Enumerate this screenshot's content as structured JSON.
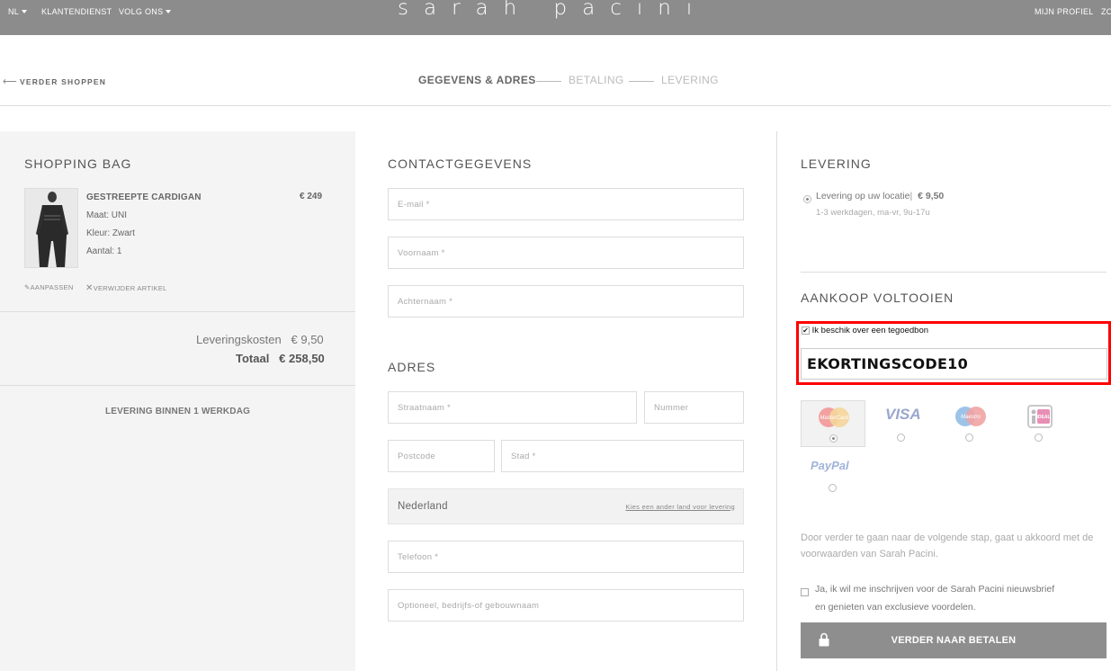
{
  "topbar": {
    "lang": "NL",
    "service": "KLANTENDIENST",
    "follow": "VOLG ONS",
    "logo": "sarah pacini",
    "profile": "MIJN PROFIEL",
    "search_partial": "ZO"
  },
  "subheader": {
    "back": "VERDER SHOPPEN",
    "steps": [
      "GEGEVENS & ADRES",
      "BETALING",
      "LEVERING"
    ]
  },
  "bag": {
    "title": "SHOPPING BAG",
    "item": {
      "name": "GESTREEPTE CARDIGAN",
      "price": "€ 249",
      "size": "Maat: UNI",
      "color": "Kleur: Zwart",
      "qty": "Aantal: 1",
      "edit": "AANPASSEN",
      "remove": "VERWIJDER ARTIKEL"
    },
    "shipping_label": "Leveringskosten",
    "shipping_value": "€ 9,50",
    "total_label": "Totaal",
    "total_value": "€ 258,50",
    "delivery_note": "LEVERING BINNEN 1 WERKDAG"
  },
  "contact": {
    "title": "CONTACTGEGEVENS",
    "email": "E-mail *",
    "firstname": "Voornaam *",
    "lastname": "Achternaam *"
  },
  "address": {
    "title": "ADRES",
    "street": "Straatnaam *",
    "number": "Nummer",
    "postcode": "Postcode",
    "city": "Stad *",
    "country": "Nederland",
    "country_link": "Kies een ander land voor levering",
    "phone": "Telefoon *",
    "company": "Optioneel, bedrijfs-of gebouwnaam"
  },
  "delivery": {
    "title": "LEVERING",
    "option_label": "Levering op uw locatie",
    "option_price": "€ 9,50",
    "option_detail": "1-3 werkdagen, ma-vr, 9u-17u"
  },
  "checkout": {
    "title": "AANKOOP VOLTOOIEN",
    "voucher_label": "Ik beschik over een tegoedbon",
    "voucher_code": "EKORTINGSCODE10",
    "payment_methods": [
      "MasterCard",
      "VISA",
      "Maestro",
      "iDEAL",
      "PayPal"
    ],
    "terms": "Door verder te gaan naar de volgende stap, gaat u akkoord met de voorwaarden van Sarah Pacini.",
    "newsletter_line1": "Ja, ik wil me inschrijven voor de Sarah Pacini nieuwsbrief",
    "newsletter_line2": "en genieten van exclusieve voordelen.",
    "cta": "VERDER NAAR BETALEN"
  },
  "colors": {
    "topbar": "#8c8c8c",
    "highlight": "#ff0000",
    "cta": "#8e8e8e"
  }
}
